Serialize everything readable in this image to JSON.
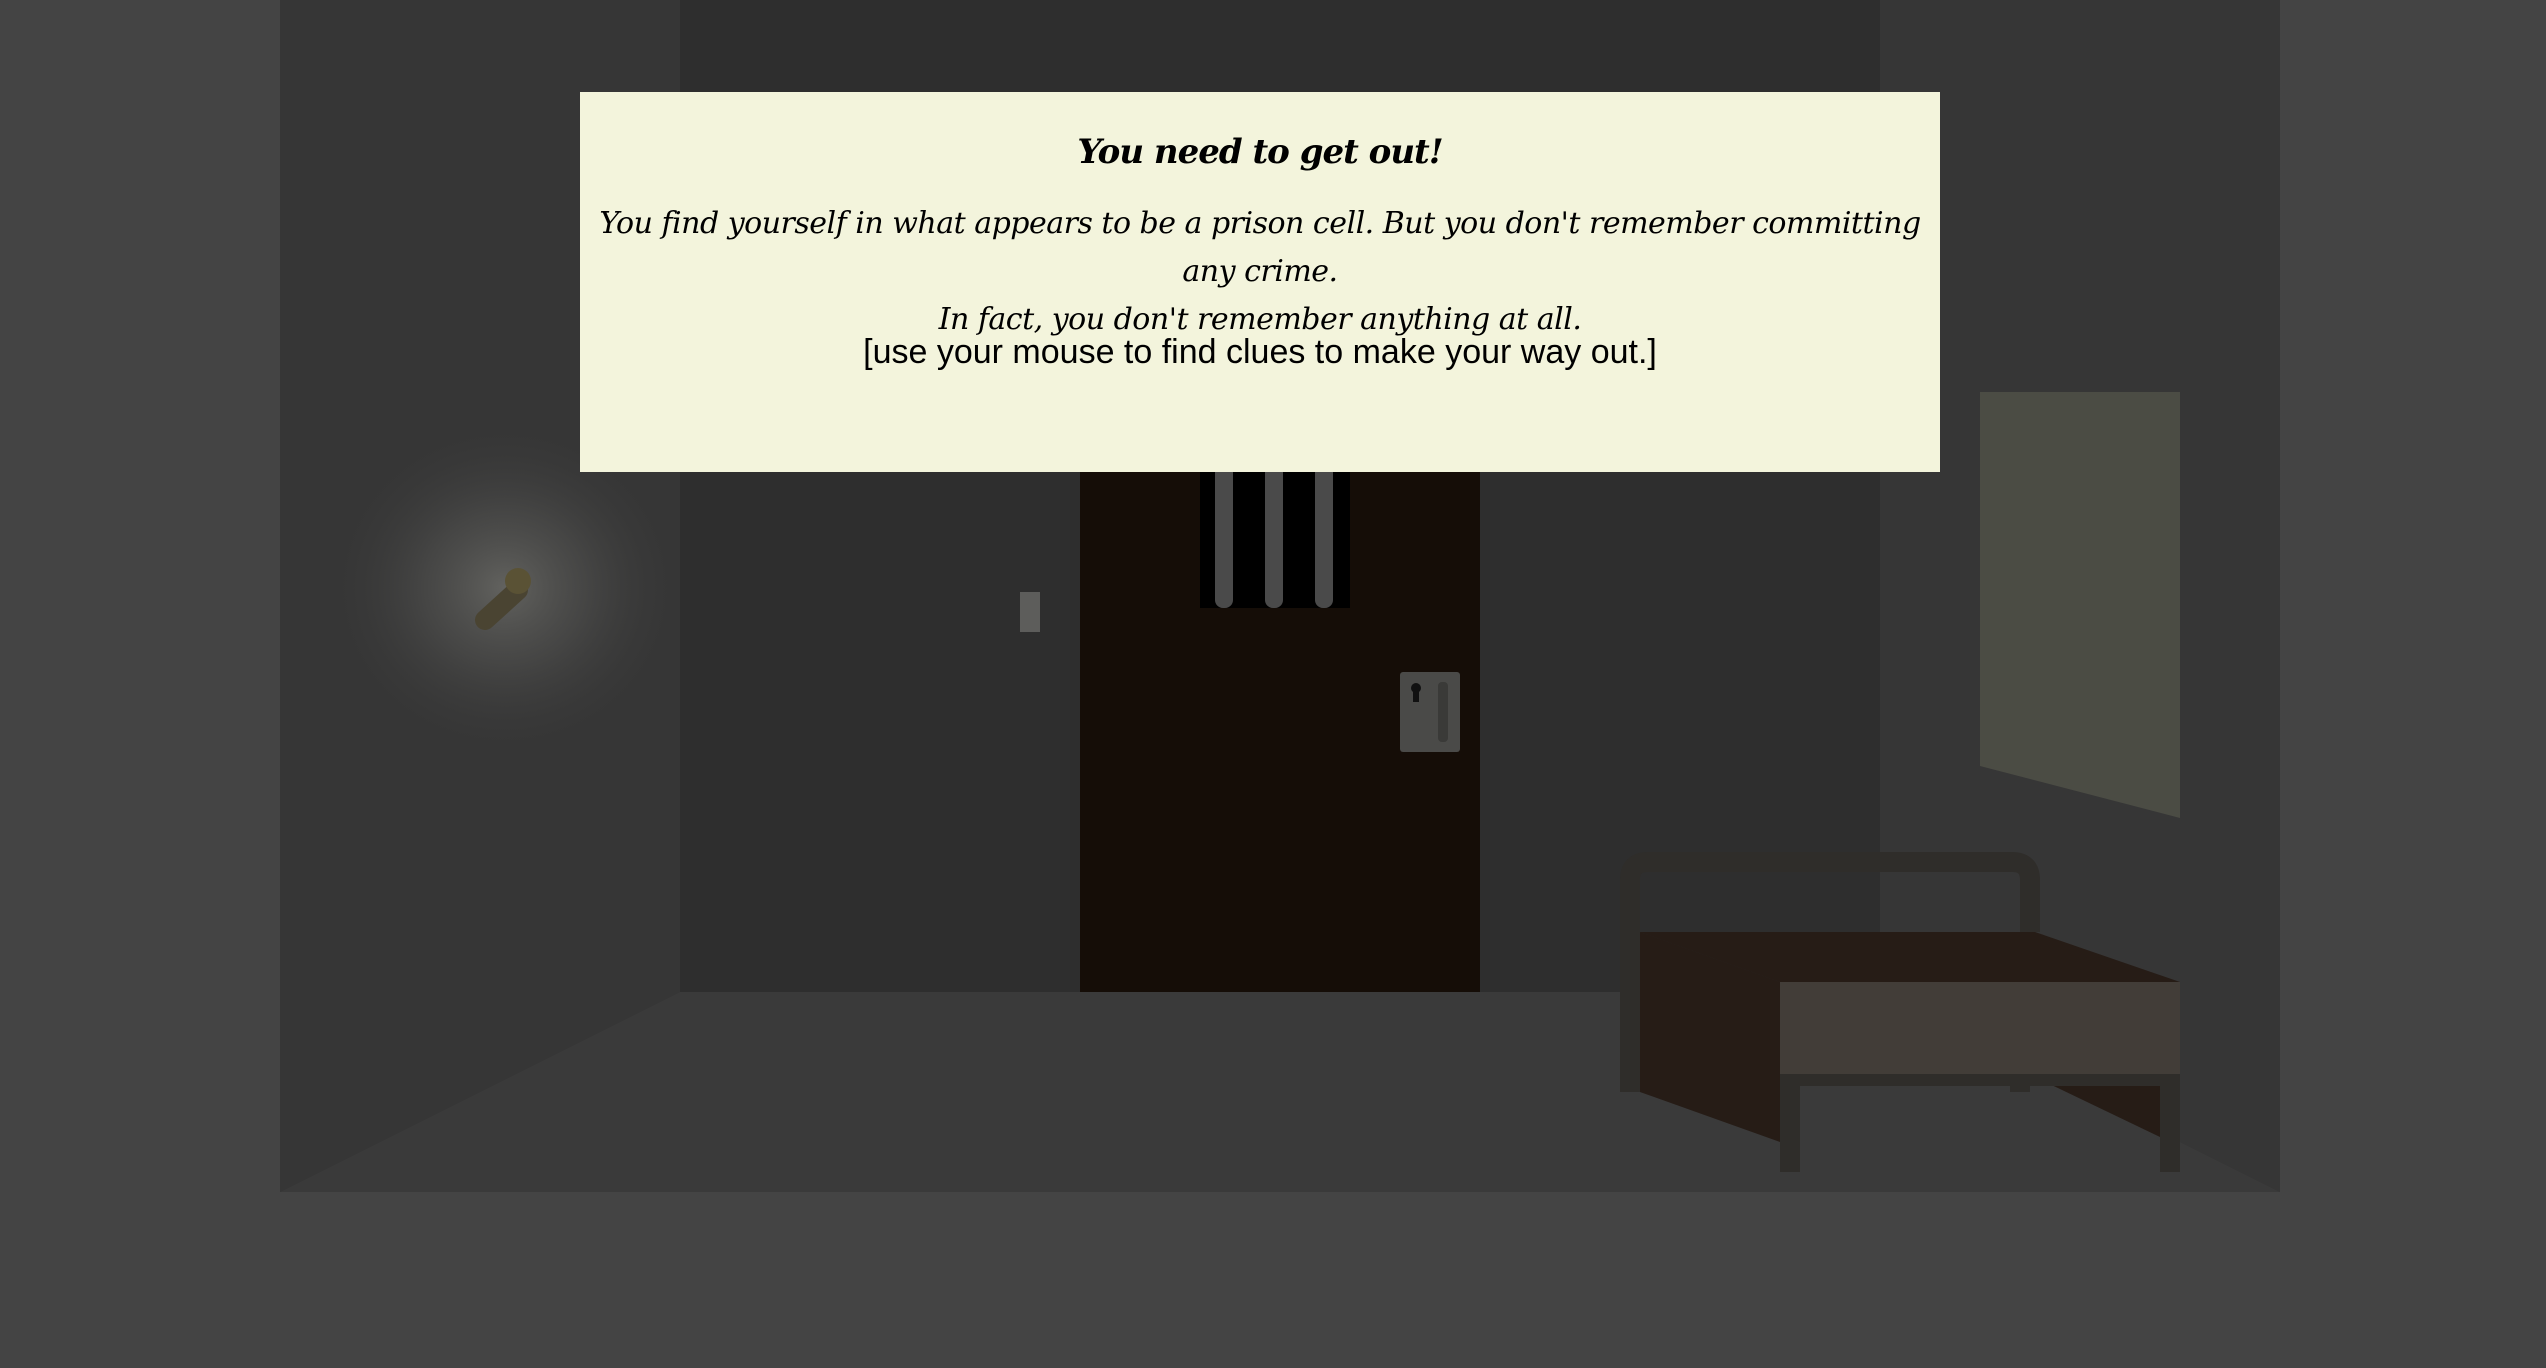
{
  "intro": {
    "title": "You need to get out!",
    "body_line1": "You find yourself in what appears to be a prison cell. But you don't remember committing any crime.",
    "body_line2": "In fact, you don't remember anything at all.",
    "hint": "[use your mouse to find clues to make your way out.]"
  },
  "scene": {
    "objects": [
      "torch-icon",
      "light-switch",
      "cell-door",
      "door-bars",
      "door-lock",
      "keyhole-icon",
      "wall-poster",
      "bed"
    ]
  },
  "colors": {
    "background": "#444444",
    "side_wall": "#363636",
    "back_wall": "#2e2e2e",
    "floor": "#3a3a3a",
    "door": "#150d07",
    "dialog": "#f3f4dc",
    "poster": "#4b4c44",
    "mattress": "#423d38",
    "bed_frame": "#2f2d2a"
  }
}
